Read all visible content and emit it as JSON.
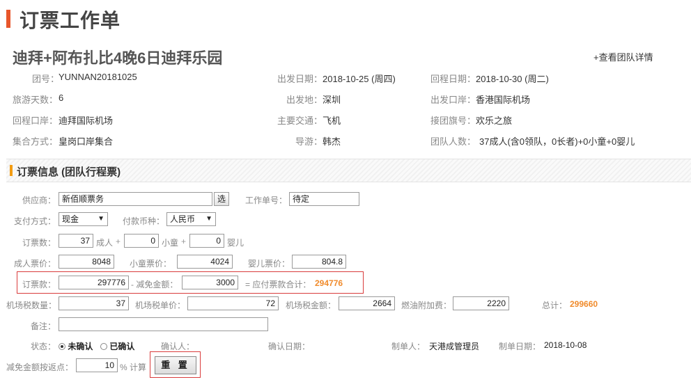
{
  "page": {
    "title": "订票工作单"
  },
  "tour": {
    "name": "迪拜+阿布扎比4晚6日迪拜乐园",
    "detail_link": "+查看团队详情",
    "fields": {
      "group_no": {
        "label": "团号：",
        "value": "YUNNAN20181025"
      },
      "depart_date": {
        "label": "出发日期：",
        "value": "2018-10-25 (周四)"
      },
      "return_date": {
        "label": "回程日期：",
        "value": "2018-10-30 (周二)"
      },
      "days": {
        "label": "旅游天数：",
        "value": "6"
      },
      "depart_place": {
        "label": "出发地：",
        "value": "深圳"
      },
      "depart_port": {
        "label": "出发口岸：",
        "value": "香港国际机场"
      },
      "return_port": {
        "label": "回程口岸：",
        "value": "迪拜国际机场"
      },
      "transport": {
        "label": "主要交通：",
        "value": "飞机"
      },
      "flag": {
        "label": "接团旗号：",
        "value": "欢乐之旅"
      },
      "gather": {
        "label": "集合方式：",
        "value": "皇岗口岸集合"
      },
      "guide": {
        "label": "导游：",
        "value": "韩杰"
      },
      "headcount": {
        "label": "团队人数：",
        "value": "37成人(含0领队，0长者)+0小童+0婴儿"
      }
    }
  },
  "ticket": {
    "section_title": "订票信息 (团队行程票)",
    "supplier": {
      "label": "供应商：",
      "value": "新佰顺票务",
      "choose": "选"
    },
    "work_no": {
      "label": "工作单号：",
      "value": "待定"
    },
    "pay_method": {
      "label": "支付方式：",
      "value": "现金"
    },
    "currency": {
      "label": "付款币种：",
      "value": "人民币"
    },
    "count": {
      "label": "订票数：",
      "adult": "37",
      "adult_unit": "成人",
      "plus1": "+",
      "child": "0",
      "child_unit": "小童",
      "plus2": "+",
      "infant": "0",
      "infant_unit": "婴儿"
    },
    "price": {
      "adult_label": "成人票价：",
      "adult": "8048",
      "child_label": "小童票价：",
      "child": "4024",
      "infant_label": "婴儿票价：",
      "infant": "804.8"
    },
    "amount": {
      "label": "订票款：",
      "value": "297776",
      "minus_label": "- 减免金额：",
      "discount": "3000",
      "payable_label": "= 应付票款合计：",
      "payable": "294776"
    },
    "tax": {
      "qty_label": "机场税数量：",
      "qty": "37",
      "unit_label": "机场税单价：",
      "unit": "72",
      "amount_label": "机场税金额：",
      "amount": "2664",
      "fuel_label": "燃油附加费：",
      "fuel": "2220",
      "total_label": "总计：",
      "total": "299660"
    },
    "remark": {
      "label": "备注：",
      "value": ""
    },
    "status": {
      "label": "状态：",
      "option_unconfirmed": "未确认",
      "option_confirmed": "已确认",
      "selected": "未确认"
    },
    "confirmer": {
      "label": "确认人：",
      "value": ""
    },
    "confirm_date": {
      "label": "确认日期：",
      "value": ""
    },
    "maker": {
      "label": "制单人：",
      "value": "天港成管理员"
    },
    "make_date": {
      "label": "制单日期：",
      "value": "2018-10-08"
    },
    "rebate": {
      "label": "减免金额按返点：",
      "value": "10",
      "unit": "% 计算"
    },
    "reset": "重 置"
  },
  "colors": {
    "accent_bar": "#e8562b",
    "section_bar": "#f39c12",
    "highlight": "#f08b2c",
    "red_frame": "#d93b3b"
  }
}
